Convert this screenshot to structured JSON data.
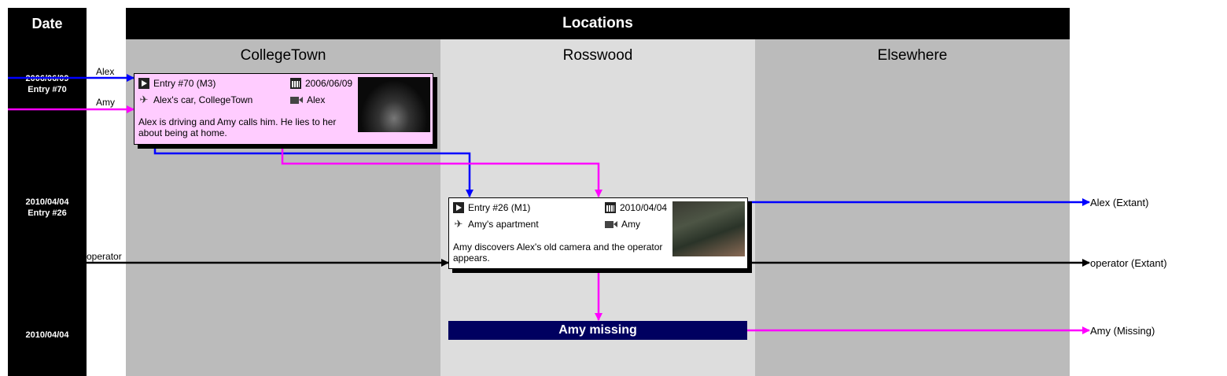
{
  "header": {
    "date_title": "Date",
    "locations_title": "Locations"
  },
  "locations": [
    "CollegeTown",
    "Rosswood",
    "Elsewhere"
  ],
  "dates": [
    {
      "date": "2006/06/09",
      "entry": "Entry #70"
    },
    {
      "date": "2010/04/04",
      "entry": "Entry #26"
    },
    {
      "date": "2010/04/04",
      "entry": ""
    }
  ],
  "entries": [
    {
      "title": "Entry #70 (M3)",
      "date": "2006/06/09",
      "place": "Alex's car, CollegeTown",
      "camera": "Alex",
      "description": "Alex is driving and Amy calls him.  He lies to her about being at home."
    },
    {
      "title": "Entry #26 (M1)",
      "date": "2010/04/04",
      "place": "Amy's apartment",
      "camera": "Amy",
      "description": "Amy discovers Alex's old camera and the operator appears."
    }
  ],
  "event": {
    "label": "Amy missing"
  },
  "characters": {
    "alex": "Alex",
    "amy": "Amy",
    "operator": "operator"
  },
  "outcomes": {
    "alex": "Alex (Extant)",
    "operator": "operator (Extant)",
    "amy": "Amy (Missing)"
  },
  "colors": {
    "alex": "#0000ff",
    "amy": "#ff00ff",
    "operator": "#000000",
    "collegetown_bg": "#bbbbbb",
    "rosswood_bg": "#dddddd",
    "elsewhere_bg": "#bbbbbb",
    "entry70_bg": "#ffccff",
    "entry26_bg": "#ffffff",
    "missing_bg": "#000060"
  },
  "icons": [
    "play-icon",
    "calendar-icon",
    "pin-icon",
    "camera-icon"
  ]
}
